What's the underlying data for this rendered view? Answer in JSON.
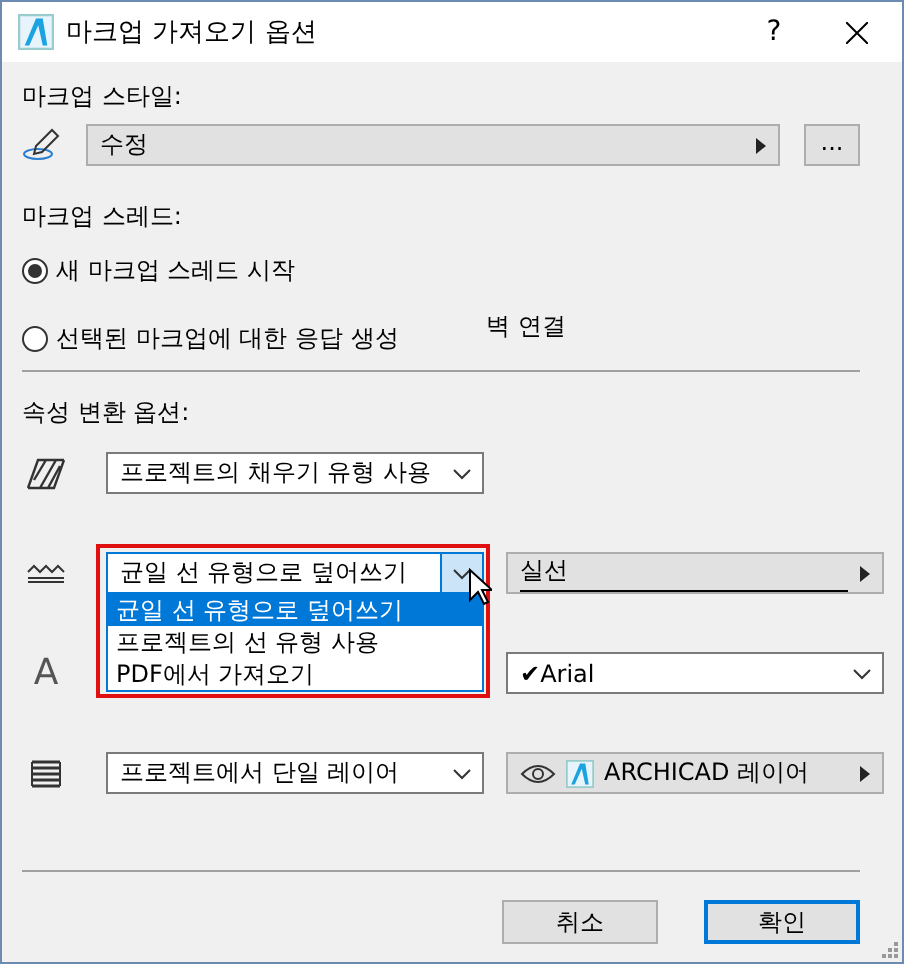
{
  "window": {
    "title": "마크업 가져오기 옵션",
    "help": "?"
  },
  "markup_style": {
    "label": "마크업 스타일:",
    "value": "수정",
    "more_button": "..."
  },
  "markup_thread": {
    "label": "마크업 스레드:",
    "options": [
      {
        "label": "새 마크업 스레드 시작",
        "selected": true
      },
      {
        "label": "선택된 마크업에 대한 응답 생성",
        "selected": false
      }
    ],
    "note": "벽 연결"
  },
  "attribute_conversion": {
    "label": "속성 변환 옵션:",
    "rows": [
      {
        "kind": "fill",
        "dropdown": "프로젝트의 채우기 유형 사용"
      },
      {
        "kind": "line",
        "dropdown": "균일 선 유형으로 덮어쓰기",
        "expanded": true,
        "options": [
          {
            "label": "균일 선 유형으로 덮어쓰기",
            "selected": true
          },
          {
            "label": "프로젝트의 선 유형 사용",
            "selected": false
          },
          {
            "label": "PDF에서 가져오기",
            "selected": false
          }
        ],
        "value": "실선"
      },
      {
        "kind": "text",
        "icon_text": "A",
        "mark": "✔",
        "value": "Arial"
      },
      {
        "kind": "layer",
        "dropdown": "프로젝트에서 단일 레이어",
        "value": "ARCHICAD 레이어"
      }
    ]
  },
  "buttons": [
    {
      "label": "취소",
      "default": false
    },
    {
      "label": "확인",
      "default": true
    }
  ]
}
